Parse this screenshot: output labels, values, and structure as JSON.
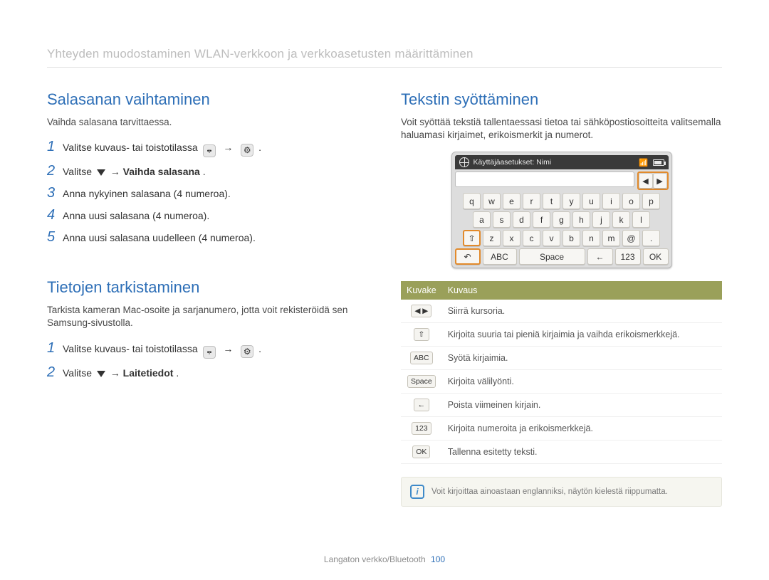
{
  "header": {
    "title": "Yhteyden muodostaminen WLAN-verkkoon ja verkkoasetusten määrittäminen"
  },
  "left": {
    "section1": {
      "heading": "Salasanan vaihtaminen",
      "intro": "Vaihda salasana tarvittaessa.",
      "steps": [
        {
          "pre": "Valitse kuvaus- tai toistotilassa ",
          "wifi": true,
          "arrow1": "→",
          "gear": true,
          "arrow2": "",
          "bold": "",
          "post": "."
        },
        {
          "pre": "Valitse ",
          "chev": true,
          "arrow1": " → ",
          "bold": "Vaihda salasana",
          "post": "."
        },
        {
          "text": "Anna nykyinen salasana (4 numeroa)."
        },
        {
          "text": "Anna uusi salasana (4 numeroa)."
        },
        {
          "text": "Anna uusi salasana uudelleen (4 numeroa)."
        }
      ]
    },
    "section2": {
      "heading": "Tietojen tarkistaminen",
      "intro": "Tarkista kameran Mac-osoite ja sarjanumero, jotta voit rekisteröidä sen Samsung-sivustolla.",
      "steps": [
        {
          "pre": "Valitse kuvaus- tai toistotilassa ",
          "wifi": true,
          "arrow1": "→",
          "gear": true,
          "arrow2": "",
          "bold": "",
          "post": "."
        },
        {
          "pre": "Valitse ",
          "chev": true,
          "arrow1": " → ",
          "bold": "Laitetiedot",
          "post": "."
        }
      ]
    }
  },
  "right": {
    "heading": "Tekstin syöttäminen",
    "intro": "Voit syöttää tekstiä tallentaessasi tietoa tai sähköpostiosoitteita valitsemalla haluamasi kirjaimet, erikoismerkit ja numerot.",
    "keyboard": {
      "header": "Käyttäjäasetukset: Nimi",
      "rows": {
        "r1": [
          "q",
          "w",
          "e",
          "r",
          "t",
          "y",
          "u",
          "i",
          "o",
          "p"
        ],
        "r2": [
          "a",
          "s",
          "d",
          "f",
          "g",
          "h",
          "j",
          "k",
          "l"
        ],
        "r3": [
          "⇧",
          "z",
          "x",
          "c",
          "v",
          "b",
          "n",
          "m",
          "@",
          "."
        ],
        "bottom": {
          "back": "↶",
          "abc": "ABC",
          "space": "Space",
          "bksp": "←",
          "num": "123",
          "ok": "OK"
        }
      }
    },
    "table": {
      "headers": {
        "icon": "Kuvake",
        "desc": "Kuvaus"
      },
      "rows": [
        {
          "icon_text": "◀ ▶",
          "desc": "Siirrä kursoria."
        },
        {
          "icon_text": "⇧",
          "desc": "Kirjoita suuria tai pieniä kirjaimia ja vaihda erikoismerkkejä."
        },
        {
          "icon_text": "ABC",
          "desc": "Syötä kirjaimia."
        },
        {
          "icon_text": "Space",
          "desc": "Kirjoita välilyönti."
        },
        {
          "icon_text": "←",
          "desc": "Poista viimeinen kirjain."
        },
        {
          "icon_text": "123",
          "desc": "Kirjoita numeroita ja erikoismerkkejä."
        },
        {
          "icon_text": "OK",
          "desc": "Tallenna esitetty teksti."
        }
      ]
    },
    "note": "Voit kirjoittaa ainoastaan englanniksi, näytön kielestä riippumatta."
  },
  "footer": {
    "text": "Langaton verkko/Bluetooth",
    "page": "100"
  }
}
